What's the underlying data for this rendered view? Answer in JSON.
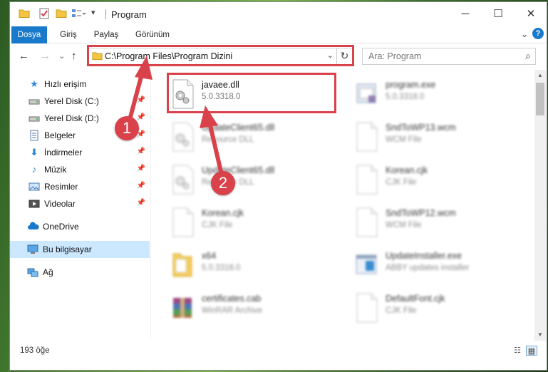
{
  "window": {
    "title": "Program",
    "controls": {
      "minimize": "─",
      "maximize": "☐",
      "close": "✕"
    }
  },
  "ribbon": {
    "tabs": [
      "Dosya",
      "Giriş",
      "Paylaş",
      "Görünüm"
    ],
    "expand_icon": "chevron-down-icon",
    "help_icon": "?"
  },
  "navigation": {
    "back": "←",
    "forward": "→",
    "recent": "⌄",
    "up": "↑",
    "address": "C:\\Program Files\\Program Dizini",
    "dropdown": "⌄",
    "refresh": "↻",
    "search_placeholder": "Ara: Program",
    "search_icon": "⌕"
  },
  "sidebar": {
    "items": [
      {
        "label": "Hızlı erişim",
        "icon": "star-icon",
        "pinned": false
      },
      {
        "label": "Yerel Disk (C:)",
        "icon": "drive-icon",
        "pinned": true
      },
      {
        "label": "Yerel Disk (D:)",
        "icon": "drive-icon",
        "pinned": true
      },
      {
        "label": "Belgeler",
        "icon": "documents-icon",
        "pinned": true
      },
      {
        "label": "İndirmeler",
        "icon": "download-icon",
        "pinned": true
      },
      {
        "label": "Müzik",
        "icon": "music-icon",
        "pinned": true
      },
      {
        "label": "Resimler",
        "icon": "pictures-icon",
        "pinned": true
      },
      {
        "label": "Videolar",
        "icon": "videos-icon",
        "pinned": true
      },
      {
        "label": "OneDrive",
        "icon": "cloud-icon",
        "pinned": false
      },
      {
        "label": "Bu bilgisayar",
        "icon": "computer-icon",
        "pinned": false,
        "selected": true
      },
      {
        "label": "Ağ",
        "icon": "network-icon",
        "pinned": false
      }
    ],
    "pin_glyph": "📌"
  },
  "files": [
    {
      "name": "javaee.dll",
      "desc": "5.0.3318.0",
      "type": "dll",
      "highlighted": true
    },
    {
      "name": "program.exe",
      "desc": "5.0.3318.0",
      "type": "exe"
    },
    {
      "name": "UpdateClient65.dll",
      "desc": "Resource DLL",
      "type": "dll"
    },
    {
      "name": "SndToWP13.wcm",
      "desc": "WCM File",
      "type": "blank"
    },
    {
      "name": "UpdateClient65.dll",
      "desc": "Resource DLL",
      "type": "dll"
    },
    {
      "name": "Korean.cjk",
      "desc": "CJK File",
      "type": "blank"
    },
    {
      "name": "Korean.cjk",
      "desc": "CJK File",
      "type": "blank"
    },
    {
      "name": "SndToWP12.wcm",
      "desc": "WCM File",
      "type": "blank"
    },
    {
      "name": "x64",
      "desc": "5.0.3318.0",
      "type": "folder"
    },
    {
      "name": "UpdateInstaller.exe",
      "desc": "ABBY updates installer",
      "type": "installer"
    },
    {
      "name": "certificates.cab",
      "desc": "WinRAR Archive",
      "type": "archive"
    },
    {
      "name": "DefaultFont.cjk",
      "desc": "CJK File",
      "type": "blank"
    }
  ],
  "status": {
    "item_count": "193 öğe"
  },
  "callouts": {
    "one": "1",
    "two": "2"
  },
  "colors": {
    "accent": "#1979ca",
    "annotation": "#d9414b",
    "selection": "#cce8ff"
  }
}
